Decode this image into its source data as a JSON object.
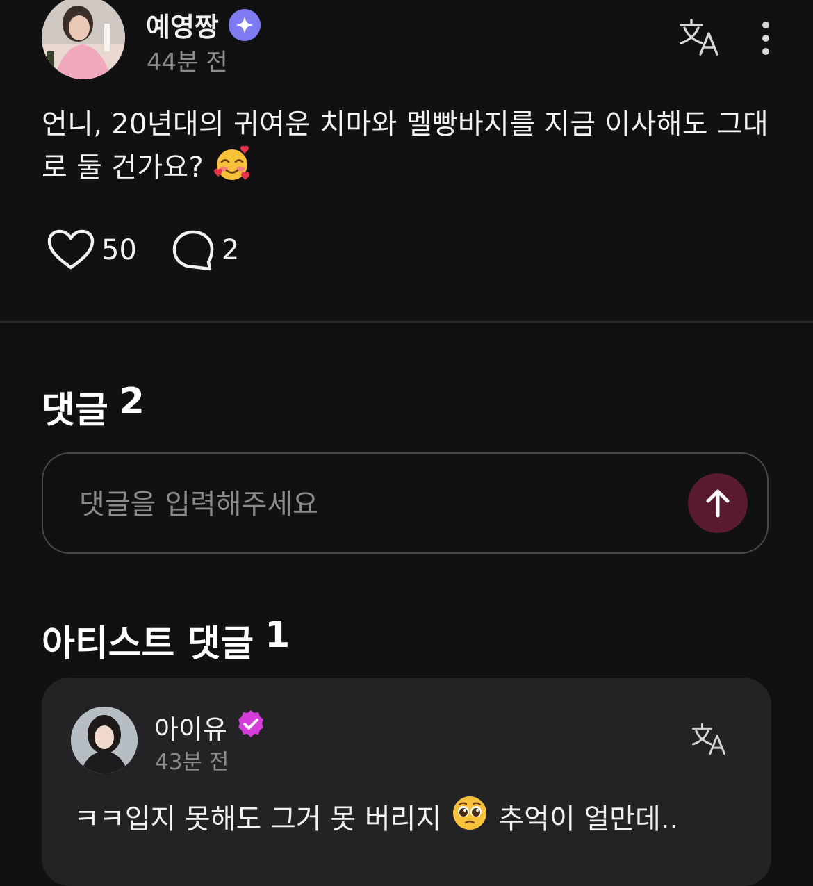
{
  "post": {
    "author": "예영짱",
    "time": "44분 전",
    "text": "언니, 20년대의 귀여운 치마와 멜빵바지를 지금 이사해도 그대로 둘 건가요?",
    "emoji": "smiling-face-with-hearts",
    "likes": "50",
    "comments": "2"
  },
  "comments": {
    "title": "댓글",
    "count": "2",
    "input": {
      "value": "",
      "placeholder": "댓글을 입력해주세요"
    }
  },
  "artist_comments": {
    "title": "아티스트 댓글",
    "count": "1",
    "items": [
      {
        "author": "아이유",
        "time": "43분 전",
        "text_before": "ㅋㅋ입지 못해도 그거 못 버리지",
        "emoji": "pleading-face",
        "text_after": "추억이 얼만데.."
      }
    ]
  },
  "colors": {
    "background": "#111112",
    "card": "#232325",
    "muted_text": "#8c8c8f",
    "send_button": "#5a1a30",
    "verified_blue": "#7e7af2",
    "verified_magenta": "#d63cd9"
  }
}
